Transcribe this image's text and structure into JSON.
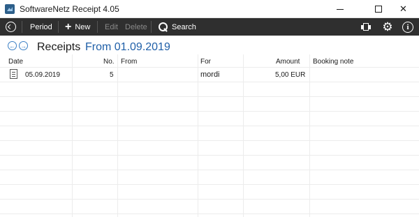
{
  "window": {
    "title": "SoftwareNetz Receipt 4.05",
    "minimize": "–",
    "maximize": "☐",
    "close": "✕"
  },
  "toolbar": {
    "period": "Period",
    "new": "New",
    "edit": "Edit",
    "delete": "Delete",
    "search": "Search",
    "gear_glyph": "⚙",
    "info_glyph": "i"
  },
  "heading": {
    "prev_glyph": "←",
    "next_glyph": "→",
    "title": "Receipts",
    "range": "From 01.09.2019"
  },
  "table": {
    "columns": [
      "Date",
      "No.",
      "From",
      "For",
      "Amount",
      "Booking note"
    ],
    "rows": [
      {
        "date": "05.09.2019",
        "no": "5",
        "from": "",
        "for": "mordi",
        "amount": "5,00 EUR",
        "note": ""
      }
    ]
  },
  "icons": [
    "back-icon",
    "plus-icon",
    "search-icon",
    "printer-icon",
    "gear-icon",
    "info-icon",
    "document-icon",
    "arrow-left-icon",
    "arrow-right-icon"
  ]
}
